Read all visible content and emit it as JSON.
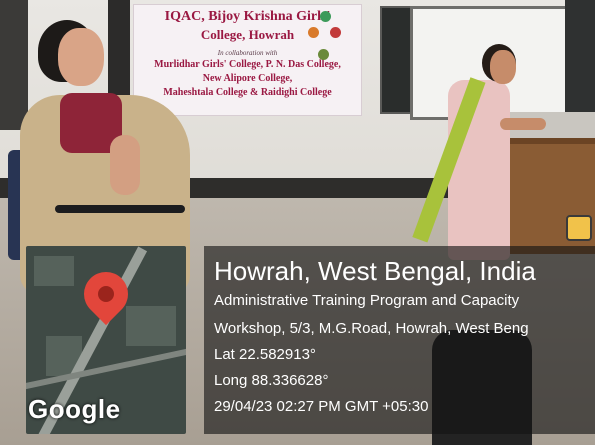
{
  "banner": {
    "line1": "IQAC, Bijoy Krishna Girls'",
    "line2": "College, Howrah",
    "line3": "In collaboration with",
    "line4": "Murlidhar Girls' College, P. N. Das College,",
    "line5": "New Alipore College,",
    "line6": "Maheshtala College & Raidighi College"
  },
  "overlay": {
    "title": "Howrah, West Bengal, India",
    "address_line1": "Administrative Training Program and Capacity",
    "address_line2": "Workshop, 5/3, M.G.Road, Howrah, West Beng",
    "latitude": "Lat 22.582913°",
    "longitude": "Long 88.336628°",
    "timestamp": "29/04/23 02:27 PM GMT +05:30",
    "map_brand": "Google"
  },
  "colors": {
    "banner_text": "#9a1842",
    "pin": "#e2463b",
    "overlay_bg": "rgba(20,20,20,0.62)"
  }
}
